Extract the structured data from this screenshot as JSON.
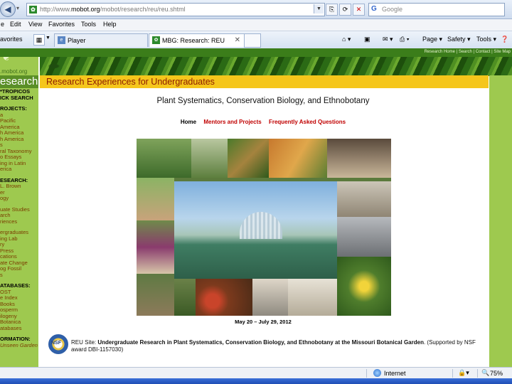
{
  "browser": {
    "url_prefix": "http://www.",
    "url_domain": "mobot.org",
    "url_path": "/mobot/research/reu/reu.shtml",
    "search_placeholder": "Google",
    "menu": [
      "e",
      "Edit",
      "View",
      "Favorites",
      "Tools",
      "Help"
    ],
    "favorites_label": "avorites",
    "tabs": [
      {
        "label": "Player",
        "active": false
      },
      {
        "label": "MBG: Research: REU",
        "active": true
      }
    ],
    "commands": [
      "Page ▾",
      "Safety ▾",
      "Tools ▾"
    ]
  },
  "site": {
    "top_links": "Research Home  |  Search  |  Contact  |  Site Map",
    "domain_label": ".mobot.org",
    "section_label": "esearch"
  },
  "sidebar": {
    "items": [
      {
        "text": "*TROPICOS",
        "style": "h"
      },
      {
        "text": "ICK SEARCH",
        "style": "h"
      },
      {
        "text": "",
        "style": "sp"
      },
      {
        "text": "ROJECTS:",
        "style": "h"
      },
      {
        "text": "a",
        "style": ""
      },
      {
        "text": "Pacific",
        "style": ""
      },
      {
        "text": "America",
        "style": ""
      },
      {
        "text": "h America",
        "style": ""
      },
      {
        "text": "h America",
        "style": ""
      },
      {
        "text": "s",
        "style": ""
      },
      {
        "text": "ral Taxonomy",
        "style": ""
      },
      {
        "text": "o Essays",
        "style": ""
      },
      {
        "text": "ing in Latin",
        "style": ""
      },
      {
        "text": "erica",
        "style": ""
      },
      {
        "text": "",
        "style": "sp"
      },
      {
        "text": "ESEARCH:",
        "style": "h"
      },
      {
        "text": "L. Brown",
        "style": ""
      },
      {
        "text": "er",
        "style": ""
      },
      {
        "text": "ogy",
        "style": ""
      },
      {
        "text": "",
        "style": "sp"
      },
      {
        "text": "uate Studies",
        "style": ""
      },
      {
        "text": "arch",
        "style": ""
      },
      {
        "text": "riences",
        "style": ""
      },
      {
        "text": "",
        "style": "sp"
      },
      {
        "text": "ergraduates",
        "style": ""
      },
      {
        "text": "ing Lab",
        "style": ""
      },
      {
        "text": "ry",
        "style": ""
      },
      {
        "text": "Press",
        "style": ""
      },
      {
        "text": "cations",
        "style": ""
      },
      {
        "text": "ate Change",
        "style": ""
      },
      {
        "text": "og Fossil",
        "style": ""
      },
      {
        "text": "s",
        "style": ""
      },
      {
        "text": "",
        "style": "sp"
      },
      {
        "text": "ATABASES:",
        "style": "h"
      },
      {
        "text": "OST",
        "style": ""
      },
      {
        "text": "e Index",
        "style": ""
      },
      {
        "text": "Books",
        "style": ""
      },
      {
        "text": "osperm",
        "style": ""
      },
      {
        "text": "ilogeny",
        "style": ""
      },
      {
        "text": "Botanica",
        "style": ""
      },
      {
        "text": "atabases",
        "style": ""
      },
      {
        "text": "",
        "style": "sp"
      },
      {
        "text": "ORMATION:",
        "style": "h"
      },
      {
        "text": "Unseen Garden",
        "style": "it"
      }
    ]
  },
  "main": {
    "title": "Research Experiences for Undergraduates",
    "subtitle": "Plant Systematics, Conservation Biology, and Ethnobotany",
    "nav": [
      {
        "label": "Home",
        "current": true
      },
      {
        "label": "Mentors and Projects",
        "current": false
      },
      {
        "label": "Frequently Asked Questions",
        "current": false
      }
    ],
    "date": "May 20 – July 29, 2012",
    "nsf_logo_text": "NSF",
    "reu_prefix": "REU Site: ",
    "reu_bold": "Undergraduate Research in Plant Systematics, Conservation Biology, and Ethnobotany at the Missouri Botanical Garden",
    "reu_suffix": ". (Supported by NSF award DBI-1157030)"
  },
  "status": {
    "zone": "Internet",
    "zoom": "75%"
  },
  "colors": {
    "title_bar": "#f5c61b",
    "title_text": "#8b1a00",
    "sidebar_green": "#9ec94f",
    "nav_red": "#c00000"
  }
}
